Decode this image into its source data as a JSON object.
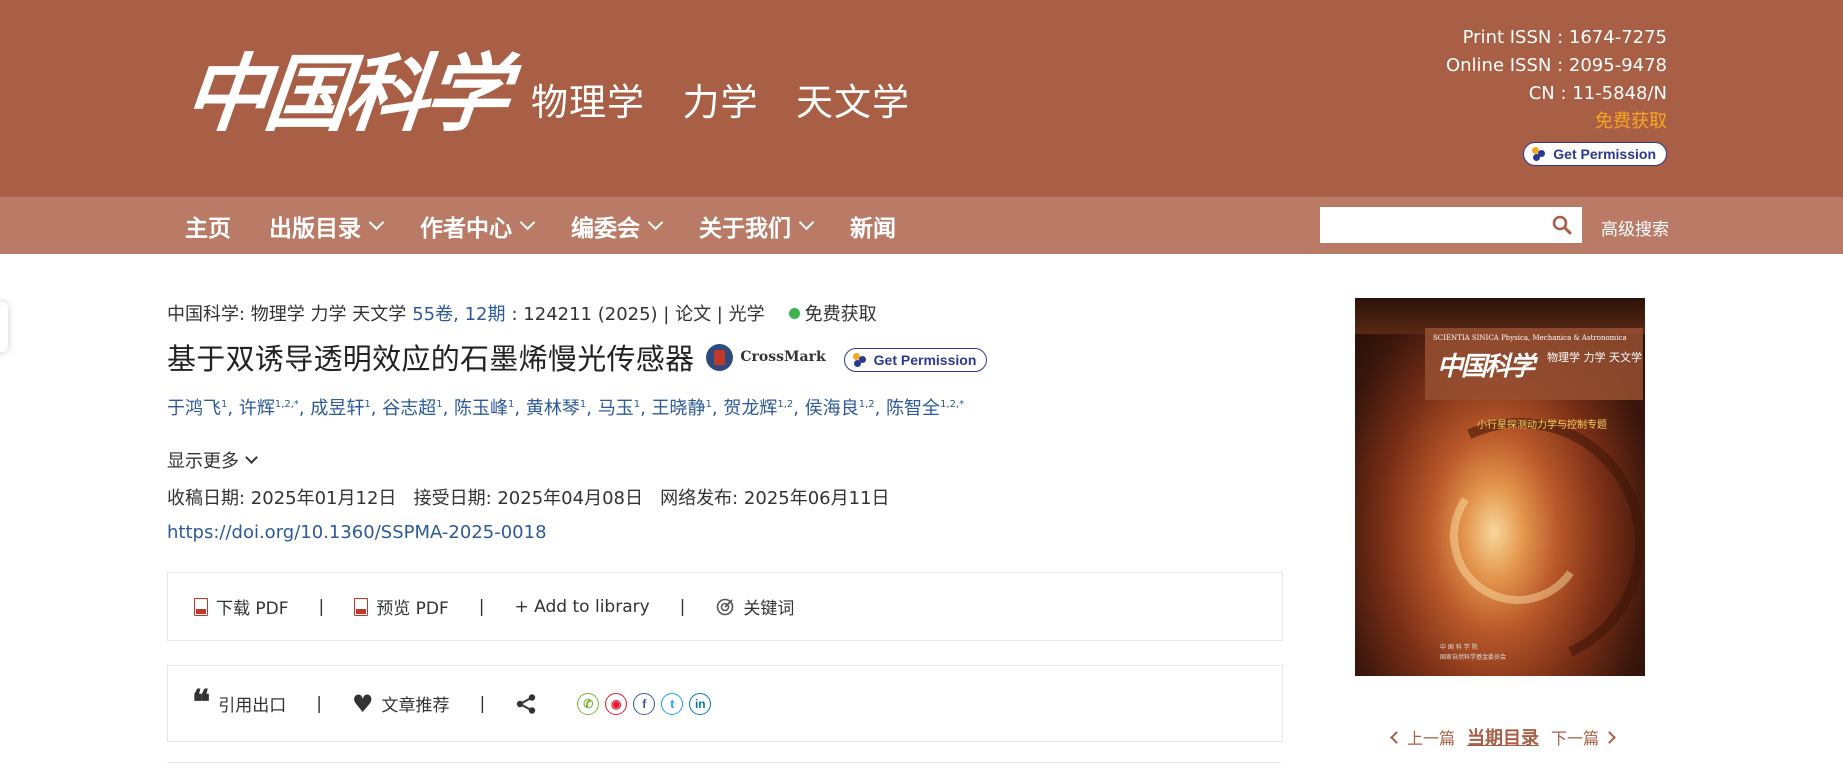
{
  "colors": {
    "header_bg": "#a95f45",
    "nav_bg": "#b97a66",
    "link": "#2d5a9b",
    "free_orange": "#f5a623",
    "open_access_green": "#3cb44b"
  },
  "header": {
    "logo_text": "中国科学",
    "journal_subtitle": "物理学  力学  天文学",
    "print_issn": "Print ISSN : 1674-7275",
    "online_issn": "Online ISSN : 2095-9478",
    "cn": "CN : 11-5848/N",
    "free_access": "免费获取",
    "get_permission": "Get Permission"
  },
  "nav": {
    "items": [
      {
        "label": "主页",
        "has_dropdown": false
      },
      {
        "label": "出版目录",
        "has_dropdown": true
      },
      {
        "label": "作者中心",
        "has_dropdown": true
      },
      {
        "label": "编委会",
        "has_dropdown": true
      },
      {
        "label": "关于我们",
        "has_dropdown": true
      },
      {
        "label": "新闻",
        "has_dropdown": false
      }
    ],
    "search_value": "",
    "advanced_search": "高级搜索"
  },
  "article": {
    "journal": "中国科学: 物理学 力学 天文学",
    "volume_issue": "55卷, 12期",
    "pages_year": ": 124211 (2025) | 论文 | 光学",
    "open_access": "免费获取",
    "title": "基于双诱导透明效应的石墨烯慢光传感器",
    "crossmark": "CrossMark",
    "get_permission": "Get Permission",
    "authors": [
      {
        "name": "于鸿飞",
        "sup": "1"
      },
      {
        "name": "许辉",
        "sup": "1,2,*"
      },
      {
        "name": "成昱轩",
        "sup": "1"
      },
      {
        "name": "谷志超",
        "sup": "1"
      },
      {
        "name": "陈玉峰",
        "sup": "1"
      },
      {
        "name": "黄林琴",
        "sup": "1"
      },
      {
        "name": "马玉",
        "sup": "1"
      },
      {
        "name": "王晓静",
        "sup": "1"
      },
      {
        "name": "贺龙辉",
        "sup": "1,2"
      },
      {
        "name": "侯海良",
        "sup": "1,2"
      },
      {
        "name": "陈智全",
        "sup": "1,2,*"
      }
    ],
    "show_more": "显示更多",
    "dates": "收稿日期: 2025年01月12日   接受日期: 2025年04月08日   网络发布: 2025年06月11日",
    "doi": "https://doi.org/10.1360/SSPMA-2025-0018"
  },
  "actions": {
    "download_pdf": "下载 PDF",
    "preview_pdf": "预览 PDF",
    "add_library": "+ Add to library",
    "keywords": "关键词",
    "cite": "引用出口",
    "recommend": "文章推荐",
    "separator": "|",
    "social": [
      {
        "name": "wechat",
        "glyph": "✆"
      },
      {
        "name": "weibo",
        "glyph": "◉"
      },
      {
        "name": "facebook",
        "glyph": "f"
      },
      {
        "name": "twitter",
        "glyph": "t"
      },
      {
        "name": "linkedin",
        "glyph": "in"
      }
    ]
  },
  "cover": {
    "scientia": "SCIENTIA SINICA Physica, Mechanica & Astronomica",
    "logo": "中国科学",
    "subtitle": "物理学 力学 天文学",
    "topic": "小行星探测动力学与控制专题",
    "publisher": "中 国 科 学 院\n国家自然科学基金委员会"
  },
  "issue_nav": {
    "prev": "上一篇",
    "current": "当期目录",
    "next": "下一篇"
  }
}
